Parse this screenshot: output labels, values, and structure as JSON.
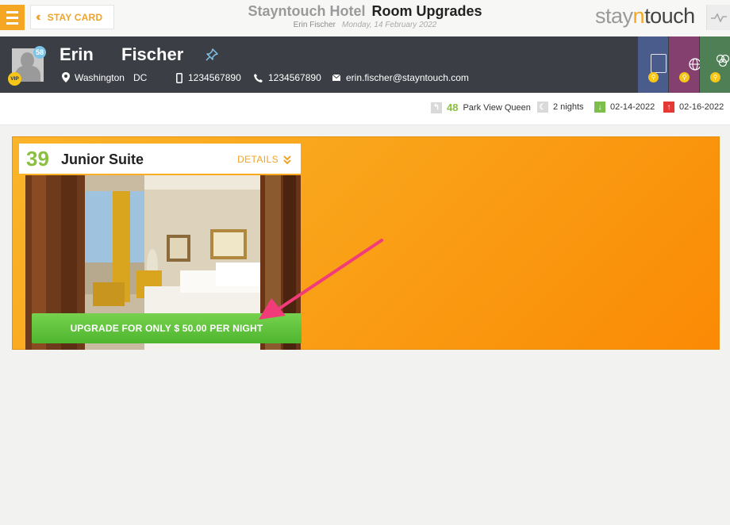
{
  "header": {
    "stay_card_label": "STAY CARD",
    "hotel_name": "Stayntouch Hotel",
    "section_title": "Room Upgrades",
    "guest_name": "Erin Fischer",
    "date": "Monday, 14 February 2022"
  },
  "logo": {
    "part1": "stay",
    "part2": "n",
    "part3": "touch"
  },
  "guest": {
    "first_name": "Erin",
    "last_name": "Fischer",
    "age": "58",
    "vip": "VIP",
    "city": "Washington",
    "state": "DC",
    "mobile": "1234567890",
    "phone": "1234567890",
    "email": "erin.fischer@stayntouch.com"
  },
  "reservation": {
    "room_number": "48",
    "room_type": "Park View Queen",
    "nights": "2 nights",
    "arrival": "02-14-2022",
    "departure": "02-16-2022"
  },
  "upgrade": {
    "room_number": "39",
    "room_type": "Junior Suite",
    "details_label": "DETAILS",
    "button_label": "UPGRADE FOR ONLY $ 50.00 PER NIGHT"
  },
  "colors": {
    "accent": "#f5a623",
    "green": "#8bbf3f",
    "header_dark": "#3b3e44",
    "arrival": "#7cc04b",
    "departure": "#e53935"
  },
  "icons": [
    "menu-icon",
    "double-chevron-left-icon",
    "activity-icon",
    "pin-icon",
    "location-icon",
    "mobile-icon",
    "phone-icon",
    "email-icon",
    "room-icon",
    "moon-icon",
    "arrow-down-icon",
    "arrow-up-icon",
    "double-chevron-down-icon",
    "search-icon"
  ]
}
